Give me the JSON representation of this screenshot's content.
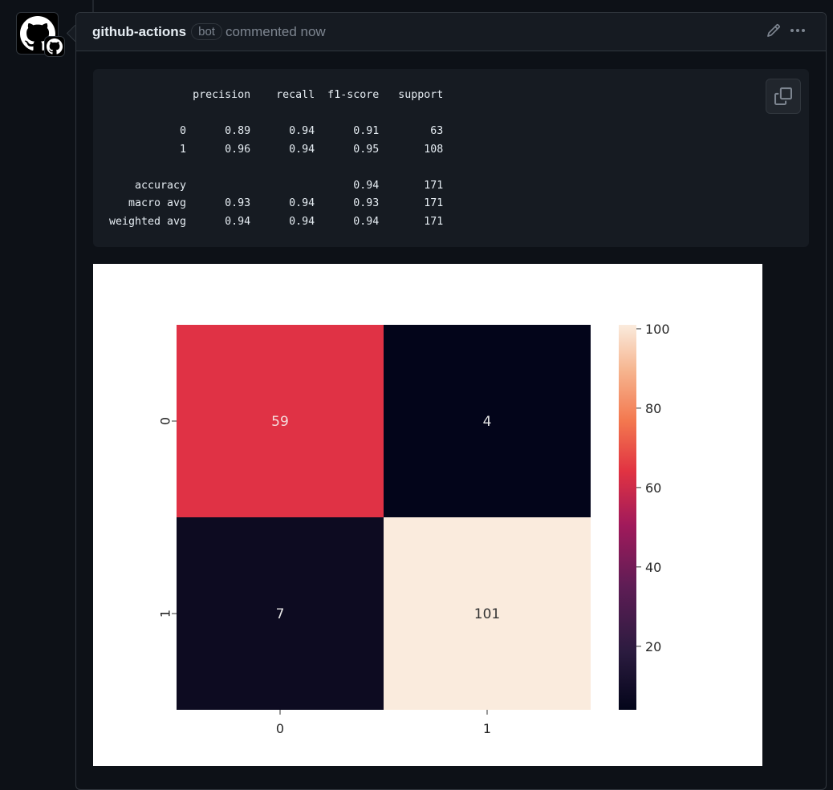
{
  "comment": {
    "author": "github-actions",
    "badge": "bot",
    "action": "commented now",
    "icons": {
      "avatar": "github-mark-icon",
      "edit": "pencil-icon",
      "more": "kebab-horizontal-icon",
      "copy": "copy-icon"
    }
  },
  "classification_report": {
    "headers": [
      "precision",
      "recall",
      "f1-score",
      "support"
    ],
    "rows": [
      {
        "label": "0",
        "precision": "0.89",
        "recall": "0.94",
        "f1": "0.91",
        "support": "63"
      },
      {
        "label": "1",
        "precision": "0.96",
        "recall": "0.94",
        "f1": "0.95",
        "support": "108"
      }
    ],
    "summary": [
      {
        "label": "accuracy",
        "precision": "",
        "recall": "",
        "f1": "0.94",
        "support": "171"
      },
      {
        "label": "macro avg",
        "precision": "0.93",
        "recall": "0.94",
        "f1": "0.93",
        "support": "171"
      },
      {
        "label": "weighted avg",
        "precision": "0.94",
        "recall": "0.94",
        "f1": "0.94",
        "support": "171"
      }
    ]
  },
  "chart_data": {
    "type": "heatmap",
    "title": "",
    "xlabel": "",
    "ylabel": "",
    "x_categories": [
      "0",
      "1"
    ],
    "y_categories": [
      "0",
      "1"
    ],
    "values": [
      [
        59,
        4
      ],
      [
        7,
        101
      ]
    ],
    "colormap": "rocket",
    "colorbar": {
      "min": 4,
      "max": 101,
      "ticks": [
        20,
        40,
        60,
        80,
        100
      ]
    },
    "cell_colors": [
      [
        "#e03245",
        "#03051a"
      ],
      [
        "#0d0b21",
        "#faebdd"
      ]
    ],
    "annotation_colors": [
      [
        "#f4dcdc",
        "#e6e6e6"
      ],
      [
        "#e6e6e6",
        "#333333"
      ]
    ]
  }
}
